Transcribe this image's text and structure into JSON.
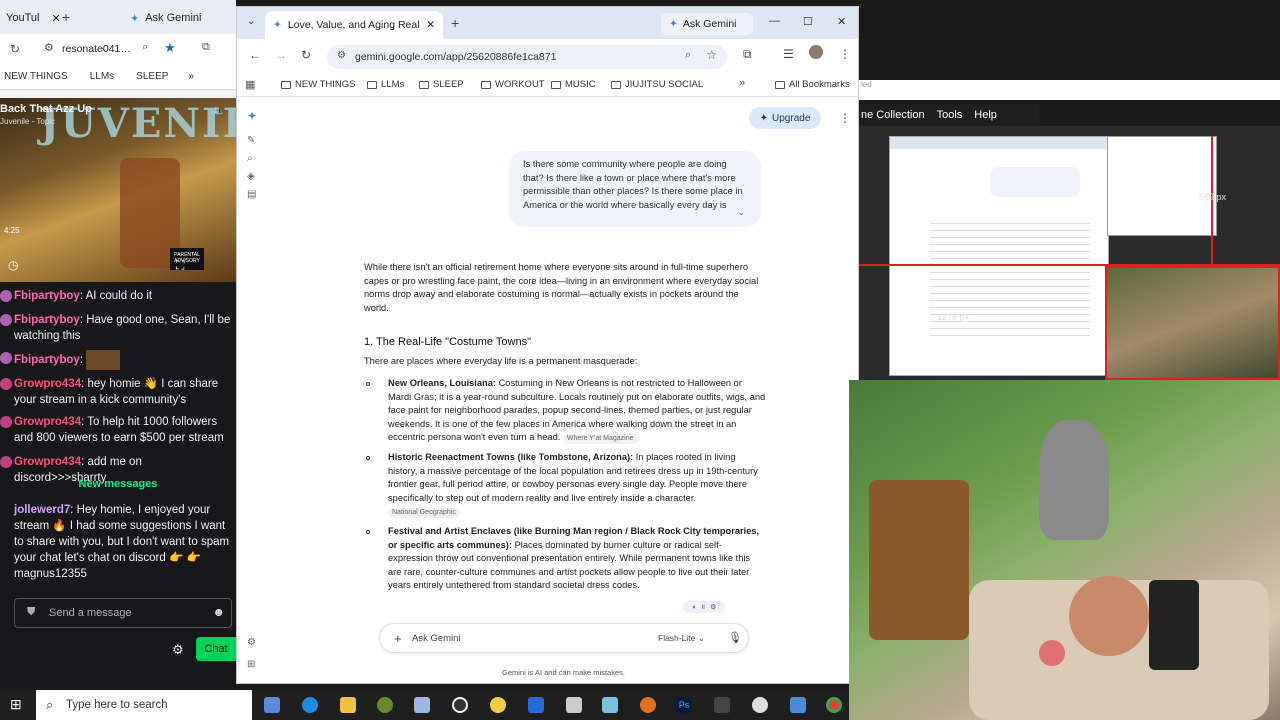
{
  "left_browser": {
    "tab_partial": "YouTul",
    "tab2_label": "Ask Gemini",
    "address": "resonate041…",
    "bookmarks": [
      "NEW THINGS",
      "LLMs",
      "SLEEP"
    ],
    "video": {
      "title": "Back That Azz Up",
      "subtitle": "Juvenile - Topic",
      "art_text": "JUVENILE",
      "time": "4:25"
    },
    "chat": {
      "messages": [
        {
          "user": "Fbipartyboy",
          "text": "AI could do it"
        },
        {
          "user": "Fbipartyboy",
          "text": "Have good one, Sean, I'll be watching this"
        },
        {
          "user": "Fbipartyboy",
          "text": ""
        },
        {
          "user": "Growpro434",
          "text": "hey homie 👋 I can share your stream in a kick community's"
        },
        {
          "user": "Growpro434",
          "text": "To help hit 1000 followers and 800 viewers to earn $500 per stream"
        },
        {
          "user": "Growpro434",
          "text": "add me on discord>>>sharrty"
        }
      ],
      "new_messages_label": "New messages",
      "last_message": {
        "user": "jollewerd7",
        "text": "Hey homie, I enjoyed your stream 🔥 I had some suggestions I want to share with you, but I don't want to spam your chat let's chat on discord 👉 👉 magnus12355"
      },
      "send_placeholder": "Send a message",
      "chat_button": "Chat"
    }
  },
  "main_browser": {
    "tab_title": "Love, Value, and Aging Realities",
    "tab2_title": "Ask Gemini",
    "url": "gemini.google.com/app/25620886fe1ca871",
    "bookmarks": [
      "NEW THINGS",
      "LLMs",
      "SLEEP",
      "WORKOUT",
      "MUSIC",
      "JIUJITSU SOCIAL"
    ],
    "all_bookmarks": "All Bookmarks",
    "gemini": {
      "upgrade_label": "Upgrade",
      "user_prompt": "Is there some community where people are doing that? Is there like a town or place where that's more permissible than other places? Is there some place in America or the world where basically every day is",
      "intro": "While there isn't an official retirement home where everyone sits around in full-time superhero capes or pro wrestling face paint, the core idea—living in an environment where everyday social norms drop away and elaborate costuming is normal—actually exists in pockets around the world.",
      "heading": "1. The Real-Life \"Costume Towns\"",
      "subheading": "There are places where everyday life is a permanent masquerade:",
      "bullets": [
        {
          "title": "New Orleans, Louisiana:",
          "text": " Costuming in New Orleans is not restricted to Halloween or Mardi Gras; it is a year-round subculture. Locals routinely put on elaborate outfits, wigs, and face paint for neighborhood parades, popup second-lines, themed parties, or just regular weekends. It is one of the few places in America where walking down the street in an eccentric persona won't even turn a head.",
          "source": "Where Y'at Magazine"
        },
        {
          "title": "Historic Reenactment Towns (like Tombstone, Arizona):",
          "text": " In places rooted in living history, a massive percentage of the local population and retirees dress up in 19th-century frontier gear, full period attire, or cowboy personas every single day. People move there specifically to step out of modern reality and live entirely inside a character.",
          "source": "National Geographic"
        },
        {
          "title": "Festival and Artist Enclaves (like Burning Man region / Black Rock City temporaries, or specific arts communes):",
          "text": " Places dominated by burner culture or radical self-expression throw out conventional presentation entirely. While permanent towns like this are rare, counter-culture communes and artist pockets allow people to live out their later years entirely untethered from standard societal dress codes.",
          "source": ""
        }
      ],
      "ask_placeholder": "Ask Gemini",
      "model_label": "Flash-Lite",
      "disclaimer": "Gemini is AI and can make mistakes."
    }
  },
  "right_panel": {
    "header_partial": "led",
    "menu": [
      "ne Collection",
      "Tools",
      "Help"
    ],
    "size_label": "1278 px",
    "size_label2": "569 px"
  },
  "taskbar": {
    "search_placeholder": "Type here to search"
  }
}
